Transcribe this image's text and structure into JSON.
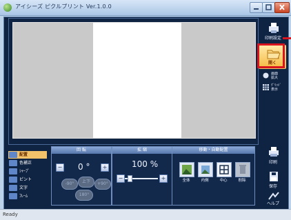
{
  "window": {
    "title": "アイシーズ ピクルプリント Ver.1.0.0",
    "status": "Ready"
  },
  "sidebar": {
    "print_top_label": "印刷設定",
    "open_label": "開く",
    "items": [
      {
        "label": "画面\n拡大",
        "icon": "zoom-icon"
      },
      {
        "label": "ｸﾞﾘｯﾄﾞ\n表示",
        "icon": "grid-icon"
      }
    ],
    "print_label": "印刷",
    "save_label": "保存",
    "help_label": "ヘルプ"
  },
  "left_menu": {
    "items": [
      {
        "label": "配置",
        "active": true
      },
      {
        "label": "色補正",
        "active": false
      },
      {
        "label": "ｼｬｰﾌﾟ",
        "active": false
      },
      {
        "label": "ピント",
        "active": false
      },
      {
        "label": "文字",
        "active": false
      },
      {
        "label": "ﾌﾚｰﾑ",
        "active": false
      }
    ]
  },
  "panels": {
    "rotate": {
      "title": "回 転",
      "value": "0 °",
      "left90": "-90°",
      "right90": "+90°",
      "flip": "上下",
      "rot180": "180°"
    },
    "zoom": {
      "title": "拡 縮",
      "value": "100 %",
      "level": 0.1
    },
    "move": {
      "title": "移動・自動配置",
      "tools": [
        "全体",
        "内側",
        "中心",
        "削除"
      ]
    }
  },
  "colors": {
    "workspace_bg": "#0f2342",
    "accent_highlight": "#d8141f",
    "active_item": "#f2c26b"
  }
}
